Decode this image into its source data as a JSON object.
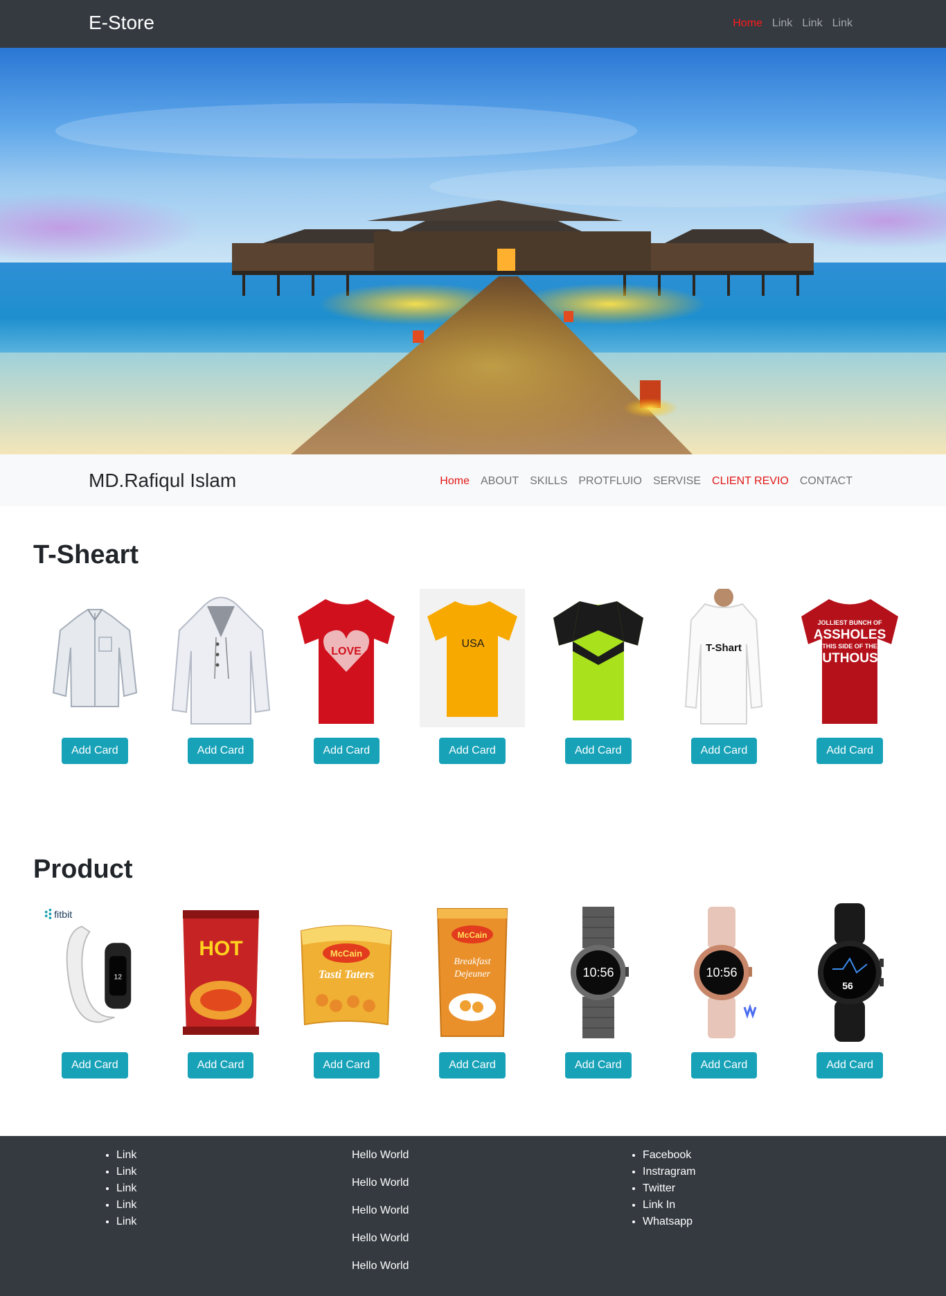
{
  "top_nav": {
    "brand": "E-Store",
    "links": [
      "Home",
      "Link",
      "Link",
      "Link"
    ],
    "active_color": "#ff1a1a"
  },
  "hero": {
    "image": "overwater-villa-pier-sunset"
  },
  "sub_nav": {
    "brand": "MD.Rafiqul Islam",
    "links": [
      "Home",
      "ABOUT",
      "SKILLS",
      "PROTFLUIO",
      "SERVISE",
      "CLIENT REVIO",
      "CONTACT"
    ]
  },
  "tshirts": {
    "title": "T-Sheart",
    "items": [
      {
        "image": "white-shirt",
        "button": "Add Card"
      },
      {
        "image": "white-hoodie",
        "button": "Add Card"
      },
      {
        "image": "red-love-tshirt",
        "button": "Add Card"
      },
      {
        "image": "yellow-usa-tshirt",
        "text": "USA",
        "button": "Add Card"
      },
      {
        "image": "green-jersey",
        "button": "Add Card"
      },
      {
        "image": "white-longsleeve",
        "text": "T-Shart",
        "button": "Add Card"
      },
      {
        "image": "red-text-tshirt",
        "text": "JOLLIEST BUNCH OF ASSHOLES THIS SIDE OF THE NUTHOUSE",
        "button": "Add Card"
      }
    ]
  },
  "products": {
    "title": "Product",
    "items": [
      {
        "image": "fitbit-band",
        "text": "fitbit",
        "button": "Add Card"
      },
      {
        "image": "hot-chips-bag",
        "text": "HOT",
        "button": "Add Card"
      },
      {
        "image": "mccain-tasti-taters",
        "text": "McCain",
        "button": "Add Card"
      },
      {
        "image": "mccain-breakfast",
        "text": "McCain",
        "button": "Add Card"
      },
      {
        "image": "smartwatch-steel",
        "text": "10:56",
        "button": "Add Card"
      },
      {
        "image": "smartwatch-rose",
        "text": "10:56",
        "button": "Add Card"
      },
      {
        "image": "smartwatch-black",
        "text": "56",
        "button": "Add Card"
      }
    ]
  },
  "footer": {
    "col1": [
      "Link",
      "Link",
      "Link",
      "Link",
      "Link"
    ],
    "col2": [
      "Hello World",
      "Hello World",
      "Hello World",
      "Hello World",
      "Hello World"
    ],
    "col3": [
      "Facebook",
      "Instragram",
      "Twitter",
      "Link In",
      "Whatsapp"
    ]
  },
  "colors": {
    "dark": "#343a40",
    "button": "#17a2b8",
    "light": "#f8f9fa"
  }
}
